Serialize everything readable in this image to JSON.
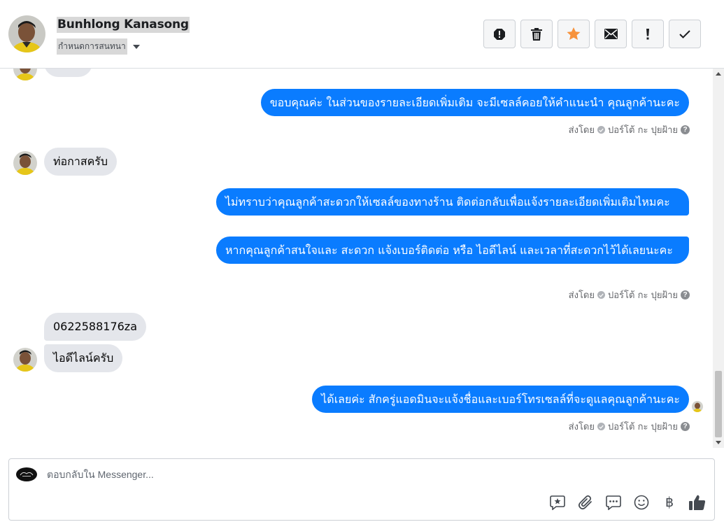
{
  "header": {
    "contact_name": "Bunhlong Kanasong",
    "assign_label": "กำหนดการสนทนา",
    "toolbar": [
      {
        "icon": "alert-circle-icon",
        "label": "spam"
      },
      {
        "icon": "trash-icon",
        "label": "delete"
      },
      {
        "icon": "star-icon",
        "label": "follow-up"
      },
      {
        "icon": "envelope-icon",
        "label": "mark-unread"
      },
      {
        "icon": "exclamation-icon",
        "label": "priority"
      },
      {
        "icon": "check-icon",
        "label": "done"
      }
    ]
  },
  "messages": [
    {
      "direction": "out",
      "text": "ขอบคุณค่ะ  ในส่วนของรายละเอียดเพิ่มเติม จะมีเซลล์คอยให้คำแนะนำ คุณลูกค้านะคะ"
    },
    {
      "direction": "in",
      "text": "ท่อกาสครับ"
    },
    {
      "direction": "out",
      "text": "ไม่ทราบว่าคุณลูกค้าสะดวกให้เซลล์ของทางร้าน ติดต่อกลับเพื่อแจ้งรายละเอียดเพิ่มเติมไหมคะ"
    },
    {
      "direction": "out",
      "text": "หากคุณลูกค้าสนใจและ สะดวก แจ้งเบอร์ติดต่อ หรือ ไอดีไลน์ และเวลาที่สะดวกไว้ได้เลยนะคะ"
    },
    {
      "direction": "in",
      "text": "0622588176za"
    },
    {
      "direction": "in",
      "text": "ไอดีไลน์ครับ"
    },
    {
      "direction": "out",
      "text": "ได้เลยค่ะ สักครู่แอดมินจะแจ้งชื่อและเบอร์โทรเซลล์ที่จะดูแลคุณลูกค้านะคะ"
    }
  ],
  "sent_by": {
    "prefix": "ส่งโดย",
    "agent": "ปอร์โต้ กะ ปุยฝ้าย",
    "help": "?"
  },
  "composer": {
    "placeholder": "ตอบกลับใน Messenger...",
    "icons": [
      "saved-reply-icon",
      "attachment-icon",
      "quick-reply-icon",
      "emoji-icon",
      "baht-icon",
      "thumbs-up-icon"
    ],
    "currency_symbol": "฿"
  },
  "colors": {
    "outgoing_bubble": "#0a7cff",
    "incoming_bubble": "#e4e6eb",
    "follow_star": "#f7923b"
  }
}
